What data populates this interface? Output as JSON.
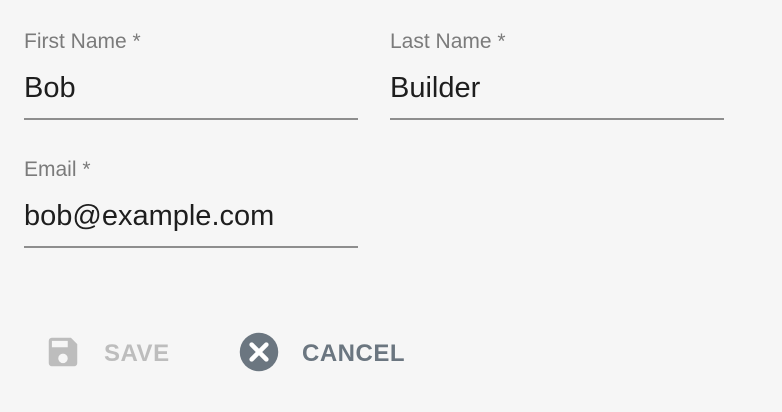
{
  "form": {
    "first_name": {
      "label": "First Name *",
      "value": "Bob"
    },
    "last_name": {
      "label": "Last Name *",
      "value": "Builder"
    },
    "email": {
      "label": "Email *",
      "value": "bob@example.com"
    }
  },
  "actions": {
    "save": {
      "label": "SAVE",
      "icon": "save-icon",
      "enabled": false,
      "color": "#bdbdbd"
    },
    "cancel": {
      "label": "CANCEL",
      "icon": "cancel-icon",
      "enabled": true,
      "color": "#6b7680"
    }
  }
}
